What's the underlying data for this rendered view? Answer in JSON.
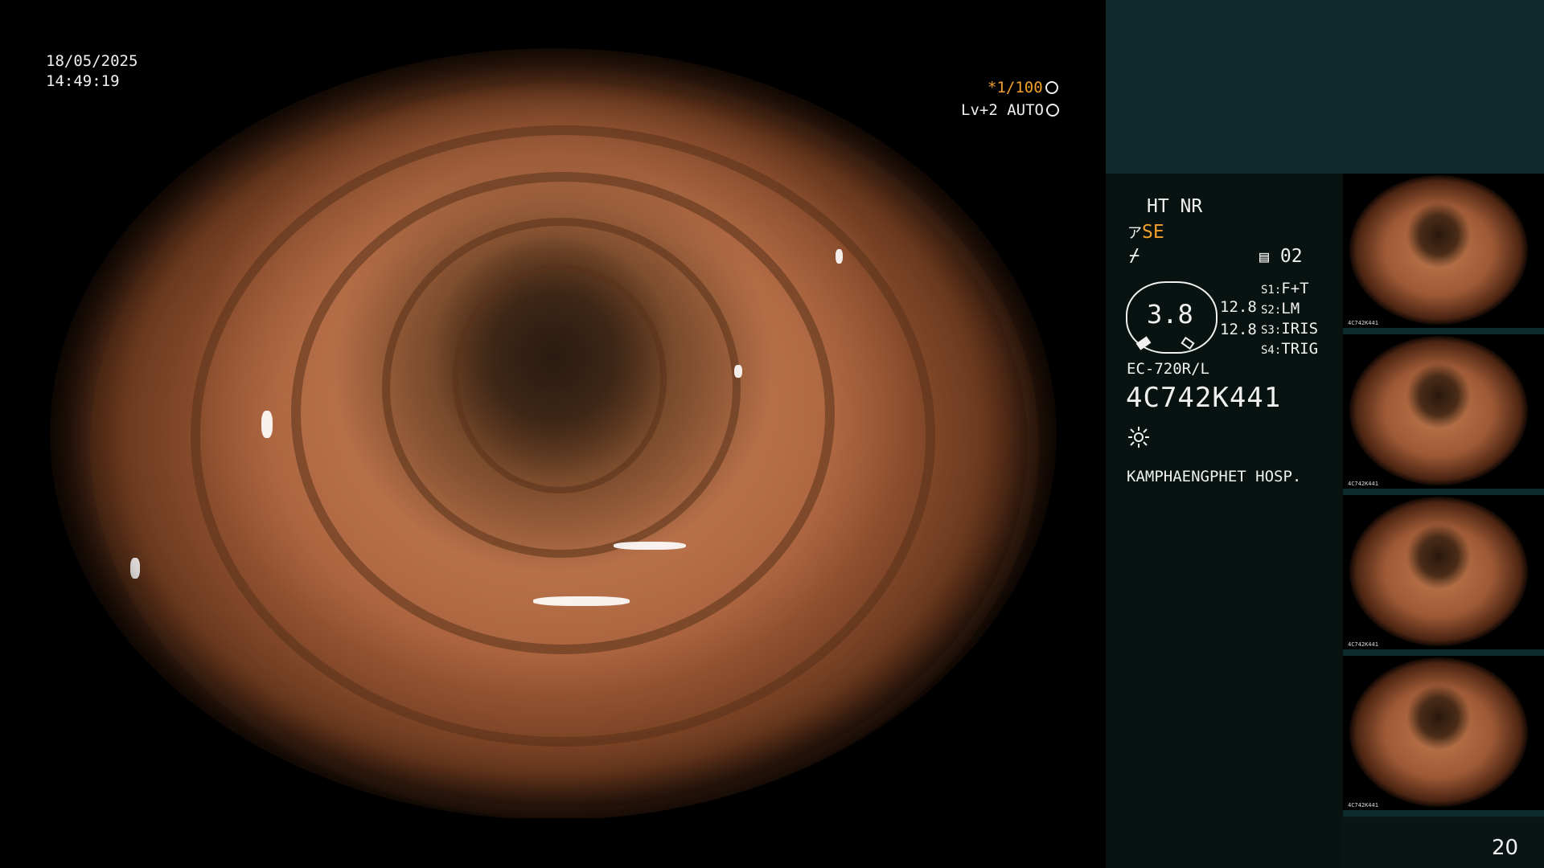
{
  "overlay": {
    "date": "18/05/2025",
    "time": "14:49:19",
    "shutter": "*1/100",
    "level": "Lv+2 AUTO"
  },
  "panel": {
    "ht_nr": "HT NR",
    "se": "SE",
    "memory": "02",
    "gauge_value": "3.8",
    "value_1": "12.8",
    "value_2": "12.8",
    "s1": {
      "label": "S1:",
      "value": "F+T"
    },
    "s2": {
      "label": "S2:",
      "value": "LM"
    },
    "s3": {
      "label": "S3:",
      "value": "IRIS"
    },
    "s4": {
      "label": "S4:",
      "value": "TRIG"
    },
    "scope_model": "EC-720R/L",
    "serial": "4C742K441",
    "hospital": "KAMPHAENGPHET HOSP."
  },
  "thumbnails": [
    {
      "caption": "4C742K441"
    },
    {
      "caption": "4C742K441"
    },
    {
      "caption": "4C742K441"
    },
    {
      "caption": "4C742K441"
    }
  ],
  "page_number": "20",
  "icons": [
    "aperture-icon",
    "brightness-icon",
    "se-icon",
    "filter-icon",
    "memory-icon",
    "light-icon"
  ],
  "colors": {
    "accent": "#f3a02a",
    "panel": "#0f2829"
  }
}
